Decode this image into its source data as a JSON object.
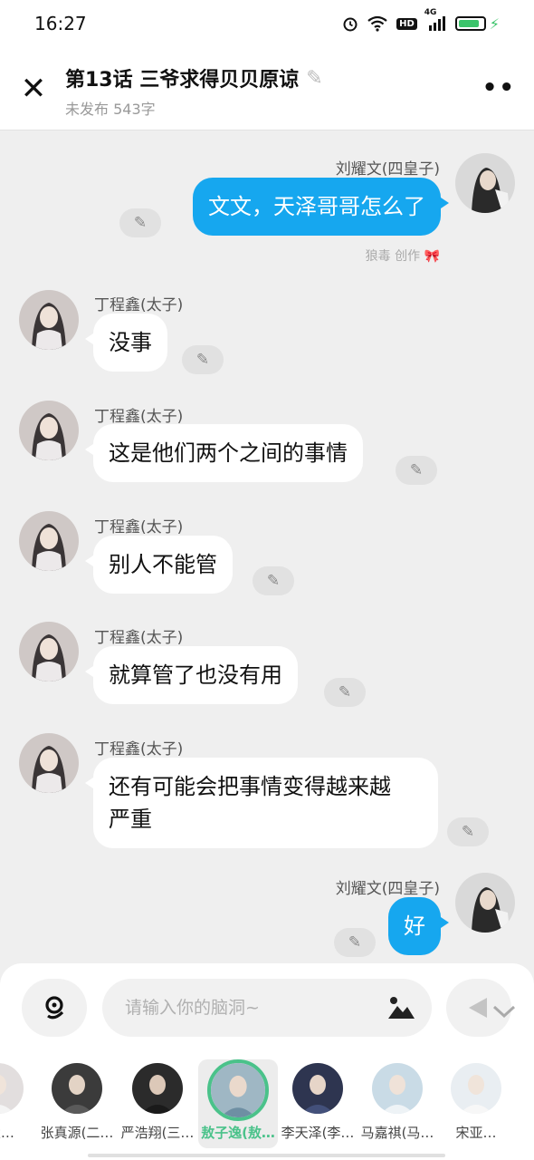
{
  "status_bar": {
    "time": "16:27",
    "hd_label": "HD",
    "network_label": "4G",
    "icons": [
      "alarm-icon",
      "wifi-icon",
      "hd-icon",
      "signal-icon",
      "battery-icon",
      "charging-icon"
    ],
    "battery_level": 0.85
  },
  "header": {
    "title": "第13话  三爷求得贝贝原谅",
    "subtitle": "未发布 543字",
    "close_icon": "close-icon",
    "more_icon": "more-icon"
  },
  "messages": [
    {
      "side": "right",
      "name": "刘耀文(四皇子)",
      "text": "文文，天泽哥哥怎么了",
      "note": "狼毒 创作 🎀"
    },
    {
      "side": "left",
      "name": "丁程鑫(太子)",
      "text": "没事"
    },
    {
      "side": "left",
      "name": "丁程鑫(太子)",
      "text": "这是他们两个之间的事情"
    },
    {
      "side": "left",
      "name": "丁程鑫(太子)",
      "text": "别人不能管"
    },
    {
      "side": "left",
      "name": "丁程鑫(太子)",
      "text": "就算管了也没有用"
    },
    {
      "side": "left",
      "name": "丁程鑫(太子)",
      "text_line1": "还有可能会把事情变得越来越",
      "text_line2": "严重"
    },
    {
      "side": "right",
      "name": "刘耀文(四皇子)",
      "text": "好"
    }
  ],
  "input": {
    "placeholder": "请输入你的脑洞~",
    "voice_icon": "voice-icon",
    "image_icon": "image-icon",
    "send_icon": "send-icon"
  },
  "characters": [
    {
      "name": "(太…"
    },
    {
      "name": "张真源(二…"
    },
    {
      "name": "严浩翔(三…"
    },
    {
      "name": "敖子逸(敖…",
      "selected": true
    },
    {
      "name": "李天泽(李…"
    },
    {
      "name": "马嘉祺(马…"
    },
    {
      "name": "宋亚…"
    }
  ],
  "colors": {
    "accent_blue": "#16a7ef",
    "selected_green": "#4ac28a",
    "background": "#efefef"
  }
}
